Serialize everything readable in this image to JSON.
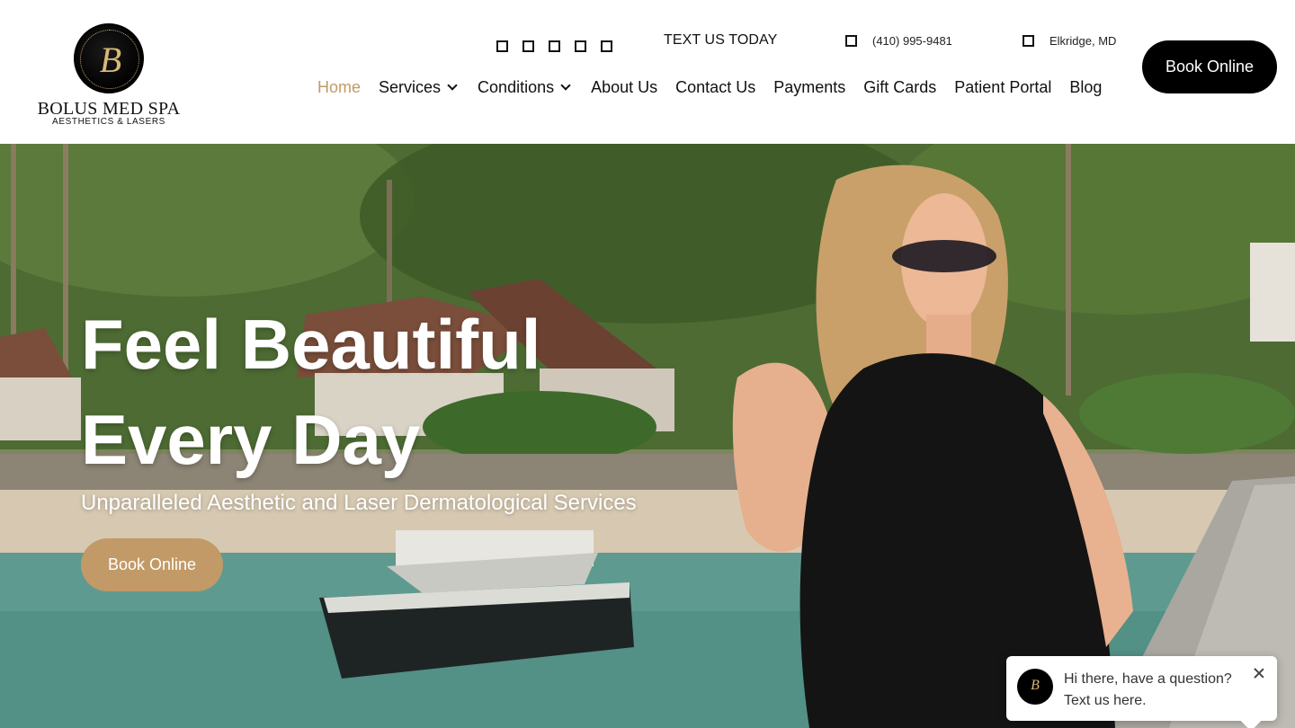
{
  "brand": {
    "logo_letter": "B",
    "name": "BOLUS MED SPA",
    "tagline": "AESTHETICS & LASERS"
  },
  "topbar": {
    "social_icons": [
      "social-icon-1",
      "social-icon-2",
      "social-icon-3",
      "social-icon-4",
      "social-icon-5"
    ],
    "text_us": "TEXT US TODAY",
    "phone": "(410) 995-9481",
    "location": "Elkridge, MD"
  },
  "nav": {
    "items": [
      {
        "label": "Home",
        "active": true
      },
      {
        "label": "Services",
        "dropdown": true
      },
      {
        "label": "Conditions",
        "dropdown": true
      },
      {
        "label": "About Us"
      },
      {
        "label": "Contact Us"
      },
      {
        "label": "Payments"
      },
      {
        "label": "Gift Cards"
      },
      {
        "label": "Patient Portal"
      },
      {
        "label": "Blog"
      }
    ],
    "cta": "Book Online"
  },
  "hero": {
    "title_line1": "Feel Beautiful",
    "title_line2": "Every Day",
    "subtitle": "Unparalleled Aesthetic and Laser Dermatological Services",
    "cta": "Book Online"
  },
  "chat": {
    "message_line1": "Hi there, have a question?",
    "message_line2": "Text us here."
  },
  "colors": {
    "accent": "#c29a67",
    "cta_dark": "#000000",
    "logo_gold": "#d8b877"
  }
}
